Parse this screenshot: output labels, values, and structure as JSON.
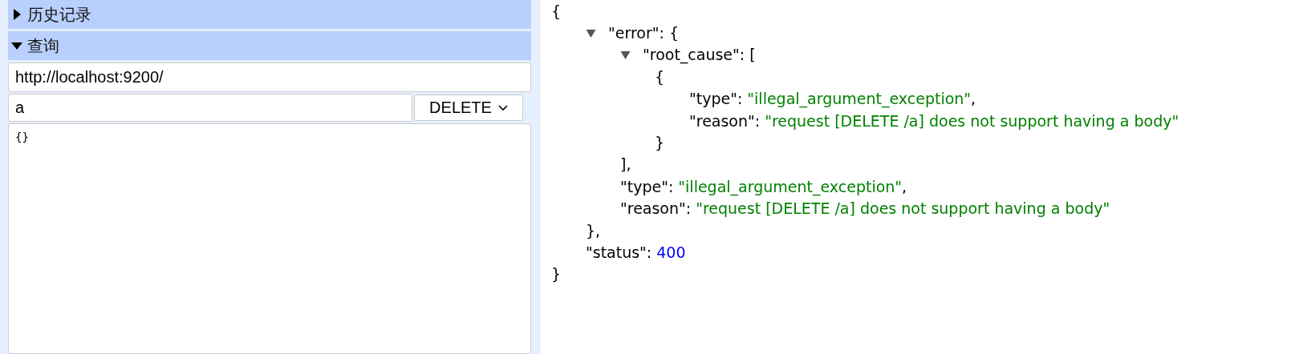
{
  "sections": [
    {
      "title": "历史记录",
      "expanded": false
    },
    {
      "title": "查询",
      "expanded": true
    }
  ],
  "query": {
    "url": "http://localhost:9200/",
    "path": "a",
    "method": "DELETE",
    "body": "{}"
  },
  "response": {
    "open": "{",
    "close": "}",
    "children": [
      {
        "key": "\"error\":",
        "open": "{",
        "close": "},",
        "expanded": true,
        "children": [
          {
            "key": "\"root_cause\":",
            "open": "[",
            "close": "],",
            "expanded": true,
            "children": [
              {
                "open": "{",
                "close": "}",
                "children": [
                  {
                    "key": "\"type\":",
                    "kind": "string",
                    "value": "\"illegal_argument_exception\"",
                    "comma": ","
                  },
                  {
                    "key": "\"reason\":",
                    "kind": "string",
                    "value": "\"request [DELETE /a] does not support having a body\""
                  }
                ]
              }
            ]
          },
          {
            "key": "\"type\":",
            "kind": "string",
            "value": "\"illegal_argument_exception\"",
            "comma": ","
          },
          {
            "key": "\"reason\":",
            "kind": "string",
            "value": "\"request [DELETE /a] does not support having a body\""
          }
        ]
      },
      {
        "key": "\"status\":",
        "kind": "number",
        "value": "400"
      }
    ]
  }
}
